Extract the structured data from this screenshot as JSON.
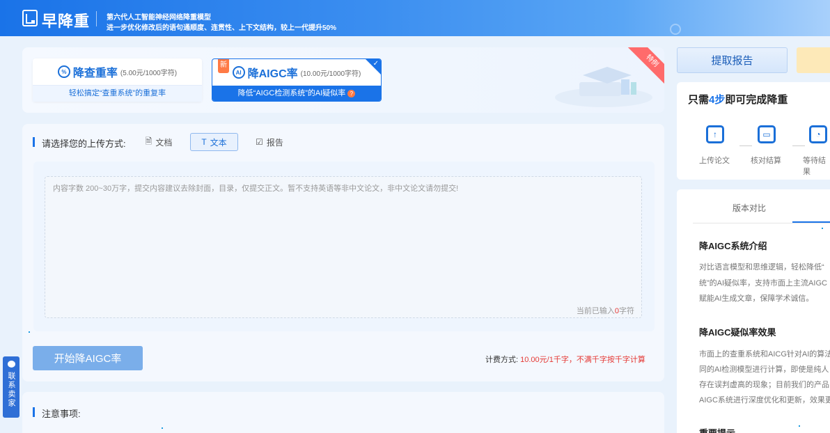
{
  "header": {
    "brand": "早降重",
    "slogan_line1": "第六代人工智能神经网络降重模型",
    "slogan_line2": "进一步优化修改后的语句通顺度、连贯性、上下文结构，较上一代提升50%"
  },
  "modes": {
    "recheck": {
      "title": "降查重率",
      "price": "(5.00元/1000字符)",
      "subtitle": "轻松搞定“查重系统”的重复率"
    },
    "aigc": {
      "badge": "新",
      "title": "降AIGC率",
      "price": "(10.00元/1000字符)",
      "subtitle": "降低“AIGC检测系统”的AI疑似率",
      "ribbon": "特例"
    }
  },
  "upload": {
    "label": "请选择您的上传方式:",
    "tabs": [
      {
        "label": "文档",
        "icon": "document-icon"
      },
      {
        "label": "文本",
        "icon": "text-icon"
      },
      {
        "label": "报告",
        "icon": "report-icon"
      }
    ],
    "active_tab": "文本",
    "placeholder": "内容字数 200~30万字，提交内容建议去除封面，目录，仅提交正文。暂不支持英语等非中文论文，非中文论文请勿提交!",
    "count_prefix": "当前已输入",
    "count_value": "0",
    "count_suffix": "字符"
  },
  "actions": {
    "start_label": "开始降AIGC率",
    "billing_label": "计费方式:",
    "billing_value": "10.00元/1千字，不满千字按千字计算"
  },
  "notice": {
    "label": "注意事项:"
  },
  "contact": {
    "label": "联系卖家"
  },
  "right": {
    "report_button": "提取报告",
    "steps_title_pre": "只需",
    "steps_title_hl": "4步",
    "steps_title_post": "即可完成降重",
    "steps": [
      "上传论文",
      "核对结算",
      "等待结果"
    ],
    "version_tab": "版本对比",
    "intro_title": "降AIGC系统介绍",
    "intro_lines": [
      "对比语言模型和思维逻辑，轻松降低“",
      "统”的AI疑似率，支持市面上主流AIGC",
      "赋能AI生成文章，保障学术诚信。"
    ],
    "effect_title": "降AIGC疑似率效果",
    "effect_lines": [
      "市面上的查重系统和AICG针对AI的算法",
      "同的AI检测模型进行计算，即使是纯人",
      "存在误判虚高的现象；目前我们的产品",
      "AIGC系统进行深度优化和更新，效果更"
    ],
    "tip_title": "重要提示"
  },
  "colors": {
    "primary": "#1a73e8",
    "accent_red": "#e53935",
    "button_disabled": "#7aaeea"
  }
}
